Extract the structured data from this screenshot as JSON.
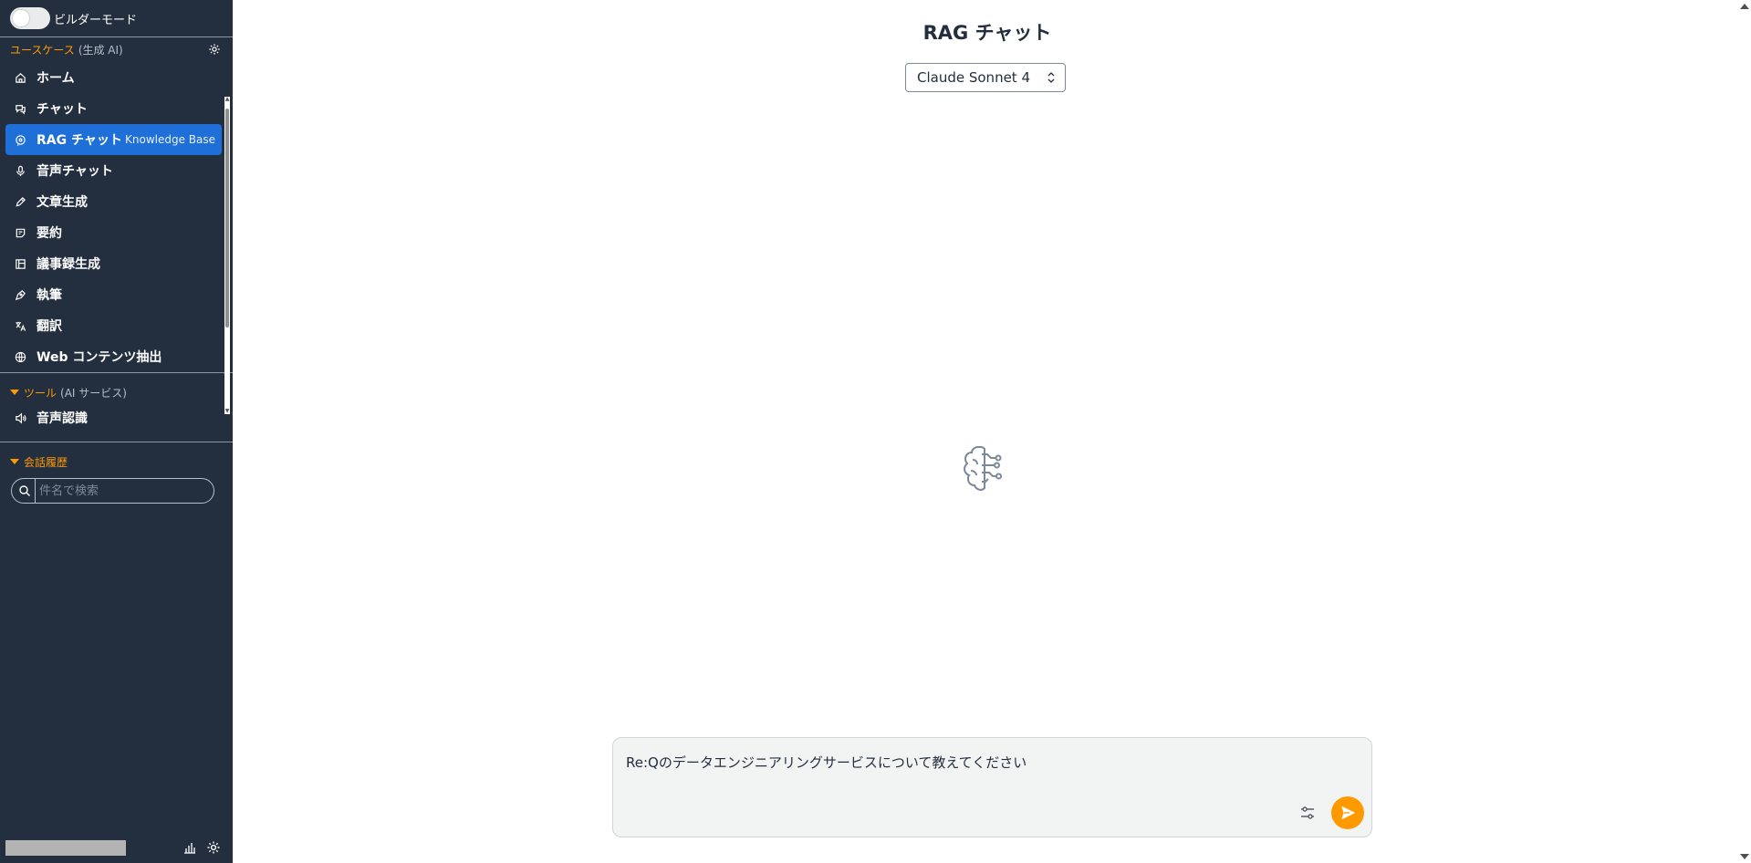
{
  "sidebar": {
    "builder_mode_label": "ビルダーモード",
    "usecases_title": "ユースケース",
    "usecases_subtitle": "(生成 AI)",
    "items": [
      {
        "label": "ホーム",
        "icon": "home-icon"
      },
      {
        "label": "チャット",
        "icon": "chat-icon"
      },
      {
        "label": "RAG チャット",
        "icon": "rag-chat-icon",
        "badge": "Knowledge Base",
        "active": true
      },
      {
        "label": "音声チャット",
        "icon": "microphone-icon"
      },
      {
        "label": "文章生成",
        "icon": "pencil-icon"
      },
      {
        "label": "要約",
        "icon": "summary-icon"
      },
      {
        "label": "議事録生成",
        "icon": "minutes-icon"
      },
      {
        "label": "執筆",
        "icon": "pen-nib-icon"
      },
      {
        "label": "翻訳",
        "icon": "translate-icon"
      },
      {
        "label": "Web コンテンツ抽出",
        "icon": "globe-icon"
      }
    ],
    "tools_title": "ツール",
    "tools_subtitle": "(AI サービス)",
    "tools_items": [
      {
        "label": "音声認識",
        "icon": "speaker-icon"
      }
    ],
    "history_title": "会話履歴",
    "history_search_placeholder": "件名で検索"
  },
  "main": {
    "title": "RAG チャット",
    "model_selected": "Claude Sonnet 4",
    "input_value": "Re:Qのデータエンジニアリングサービスについて教えてください"
  },
  "colors": {
    "sidebar_bg": "#232f3e",
    "accent_orange": "#ff9900",
    "active_blue": "#1f6fd8"
  }
}
